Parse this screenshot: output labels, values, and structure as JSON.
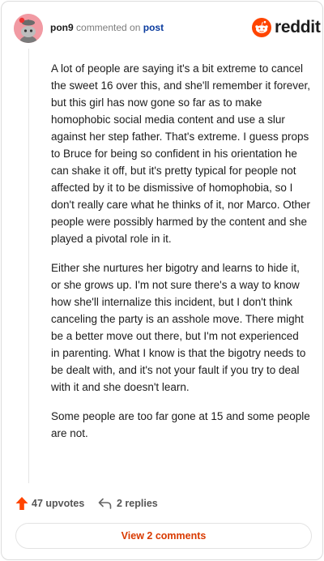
{
  "header": {
    "username": "pon9",
    "commented_text": "commented on",
    "post_link": "post",
    "brand": "reddit"
  },
  "comment": {
    "paragraphs": [
      "A lot of people are saying it's a bit extreme to cancel the sweet 16 over this, and she'll remember it forever, but this girl has now gone so far as to make homophobic social media content and use a slur against her step father. That's extreme. I guess props to Bruce for being so confident in his orientation he can shake it off, but it's pretty typical for people not affected by it to be dismissive of homophobia, so I don't really care what he thinks of it, nor Marco. Other people were possibly harmed by the content and she played a pivotal role in it.",
      "Either she nurtures her bigotry and learns to hide it, or she grows up. I'm not sure there's a way to know how she'll internalize this incident, but I don't think canceling the party is an asshole move. There might be a better move out there, but I'm not experienced in parenting. What I know is that the bigotry needs to be dealt with, and it's not your fault if you try to deal with it and she doesn't learn.",
      "Some people are too far gone at 15 and some people are not."
    ]
  },
  "actions": {
    "upvotes": "47 upvotes",
    "replies": "2 replies"
  },
  "footer": {
    "view_comments": "View 2 comments"
  },
  "colors": {
    "accent": "#d93a00",
    "reddit_orange": "#ff4500",
    "post_link": "#0a3b9e",
    "avatar_bg": "#f19aa3"
  },
  "icons": {
    "avatar": "snoo-avatar",
    "brand": "reddit-logo",
    "upvote": "upvote-arrow-icon",
    "reply": "reply-arrow-icon"
  }
}
